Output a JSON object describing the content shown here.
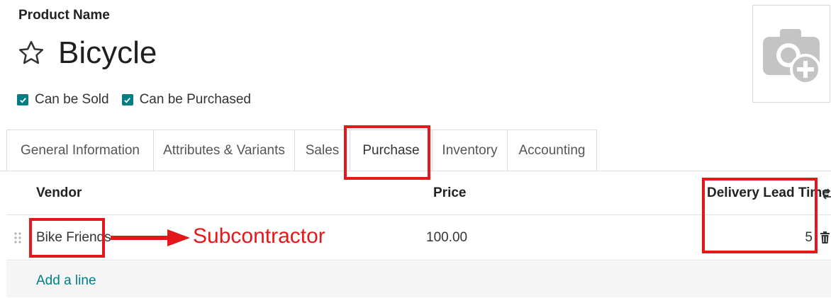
{
  "product": {
    "field_label": "Product Name",
    "name": "Bicycle"
  },
  "options": {
    "can_be_sold": "Can be Sold",
    "can_be_purchased": "Can be Purchased"
  },
  "tabs": [
    {
      "label": "General Information"
    },
    {
      "label": "Attributes & Variants"
    },
    {
      "label": "Sales"
    },
    {
      "label": "Purchase"
    },
    {
      "label": "Inventory"
    },
    {
      "label": "Accounting"
    }
  ],
  "table": {
    "headers": {
      "vendor": "Vendor",
      "price": "Price",
      "lead_time": "Delivery Lead Time"
    },
    "rows": [
      {
        "vendor": "Bike Friends",
        "price": "100.00",
        "lead_time": "5"
      }
    ],
    "add_line": "Add a line"
  },
  "annotation": {
    "text": "Subcontractor",
    "color": "#e4171b"
  },
  "colors": {
    "accent": "#017e84",
    "highlight": "#e4171b"
  },
  "icons": [
    "star-icon",
    "checkbox-checked-icon",
    "camera-add-icon",
    "drag-handle-icon",
    "trash-icon",
    "column-settings-icon",
    "arrow-right-icon"
  ]
}
